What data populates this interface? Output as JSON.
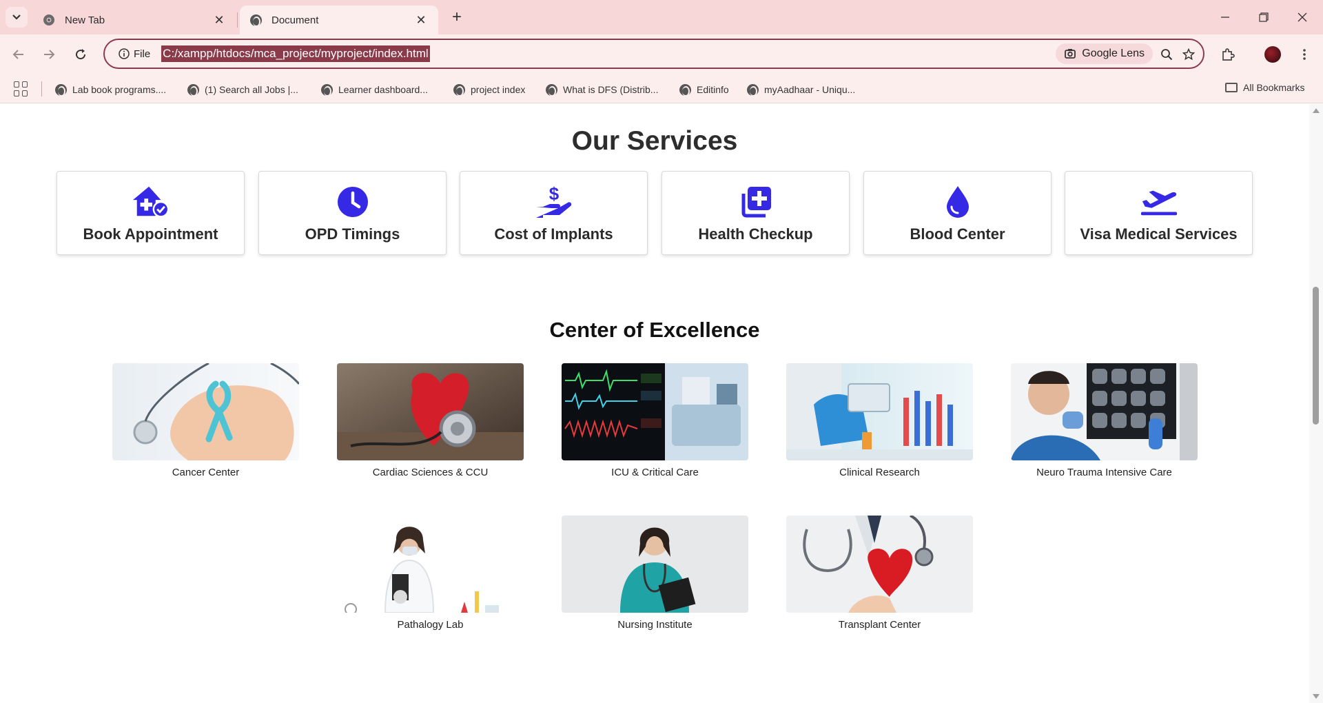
{
  "browser": {
    "tabs": [
      {
        "title": "New Tab",
        "active": false
      },
      {
        "title": "Document",
        "active": true
      }
    ],
    "address": {
      "scheme_label": "File",
      "url": "C:/xampp/htdocs/mca_project/myproject/index.html"
    },
    "lens_label": "Google Lens",
    "bookmarks": [
      "Lab book programs....",
      "(1) Search all Jobs |...",
      "Learner dashboard...",
      "project index",
      "What is DFS (Distrib...",
      "Editinfo",
      "myAadhaar - Uniqu..."
    ],
    "all_bookmarks_label": "All Bookmarks"
  },
  "colors": {
    "accent": "#3529e6",
    "chrome": "#f8d7d9",
    "url_highlight": "#8b3a4a"
  },
  "services": {
    "title": "Our Services",
    "items": [
      {
        "label": "Book Appointment",
        "icon": "house-medical-check-icon"
      },
      {
        "label": "OPD Timings",
        "icon": "clock-icon"
      },
      {
        "label": "Cost of Implants",
        "icon": "hand-holding-dollar-icon"
      },
      {
        "label": "Health Checkup",
        "icon": "notes-medical-icon"
      },
      {
        "label": "Blood Center",
        "icon": "droplet-icon"
      },
      {
        "label": "Visa Medical Services",
        "icon": "plane-departure-icon"
      }
    ]
  },
  "excellence": {
    "title": "Center of Excellence",
    "items": [
      {
        "label": "Cancer Center"
      },
      {
        "label": "Cardiac Sciences & CCU"
      },
      {
        "label": "ICU & Critical Care"
      },
      {
        "label": "Clinical Research"
      },
      {
        "label": "Neuro Trauma Intensive Care"
      },
      {
        "label": "Pathalogy Lab"
      },
      {
        "label": "Nursing Institute"
      },
      {
        "label": "Transplant Center"
      }
    ]
  }
}
